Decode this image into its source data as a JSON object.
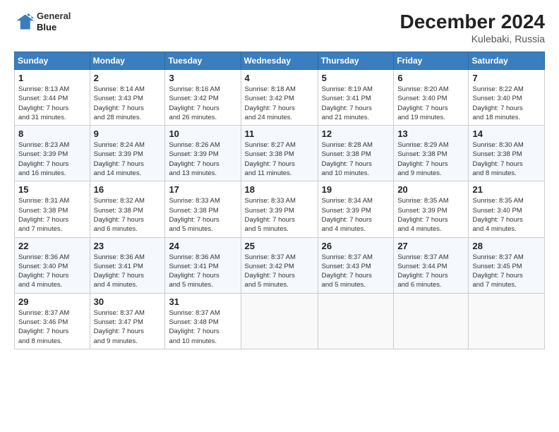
{
  "header": {
    "logo_line1": "General",
    "logo_line2": "Blue",
    "month_title": "December 2024",
    "subtitle": "Kulebaki, Russia"
  },
  "weekdays": [
    "Sunday",
    "Monday",
    "Tuesday",
    "Wednesday",
    "Thursday",
    "Friday",
    "Saturday"
  ],
  "weeks": [
    [
      {
        "day": "1",
        "info": "Sunrise: 8:13 AM\nSunset: 3:44 PM\nDaylight: 7 hours\nand 31 minutes."
      },
      {
        "day": "2",
        "info": "Sunrise: 8:14 AM\nSunset: 3:43 PM\nDaylight: 7 hours\nand 28 minutes."
      },
      {
        "day": "3",
        "info": "Sunrise: 8:16 AM\nSunset: 3:42 PM\nDaylight: 7 hours\nand 26 minutes."
      },
      {
        "day": "4",
        "info": "Sunrise: 8:18 AM\nSunset: 3:42 PM\nDaylight: 7 hours\nand 24 minutes."
      },
      {
        "day": "5",
        "info": "Sunrise: 8:19 AM\nSunset: 3:41 PM\nDaylight: 7 hours\nand 21 minutes."
      },
      {
        "day": "6",
        "info": "Sunrise: 8:20 AM\nSunset: 3:40 PM\nDaylight: 7 hours\nand 19 minutes."
      },
      {
        "day": "7",
        "info": "Sunrise: 8:22 AM\nSunset: 3:40 PM\nDaylight: 7 hours\nand 18 minutes."
      }
    ],
    [
      {
        "day": "8",
        "info": "Sunrise: 8:23 AM\nSunset: 3:39 PM\nDaylight: 7 hours\nand 16 minutes."
      },
      {
        "day": "9",
        "info": "Sunrise: 8:24 AM\nSunset: 3:39 PM\nDaylight: 7 hours\nand 14 minutes."
      },
      {
        "day": "10",
        "info": "Sunrise: 8:26 AM\nSunset: 3:39 PM\nDaylight: 7 hours\nand 13 minutes."
      },
      {
        "day": "11",
        "info": "Sunrise: 8:27 AM\nSunset: 3:38 PM\nDaylight: 7 hours\nand 11 minutes."
      },
      {
        "day": "12",
        "info": "Sunrise: 8:28 AM\nSunset: 3:38 PM\nDaylight: 7 hours\nand 10 minutes."
      },
      {
        "day": "13",
        "info": "Sunrise: 8:29 AM\nSunset: 3:38 PM\nDaylight: 7 hours\nand 9 minutes."
      },
      {
        "day": "14",
        "info": "Sunrise: 8:30 AM\nSunset: 3:38 PM\nDaylight: 7 hours\nand 8 minutes."
      }
    ],
    [
      {
        "day": "15",
        "info": "Sunrise: 8:31 AM\nSunset: 3:38 PM\nDaylight: 7 hours\nand 7 minutes."
      },
      {
        "day": "16",
        "info": "Sunrise: 8:32 AM\nSunset: 3:38 PM\nDaylight: 7 hours\nand 6 minutes."
      },
      {
        "day": "17",
        "info": "Sunrise: 8:33 AM\nSunset: 3:38 PM\nDaylight: 7 hours\nand 5 minutes."
      },
      {
        "day": "18",
        "info": "Sunrise: 8:33 AM\nSunset: 3:39 PM\nDaylight: 7 hours\nand 5 minutes."
      },
      {
        "day": "19",
        "info": "Sunrise: 8:34 AM\nSunset: 3:39 PM\nDaylight: 7 hours\nand 4 minutes."
      },
      {
        "day": "20",
        "info": "Sunrise: 8:35 AM\nSunset: 3:39 PM\nDaylight: 7 hours\nand 4 minutes."
      },
      {
        "day": "21",
        "info": "Sunrise: 8:35 AM\nSunset: 3:40 PM\nDaylight: 7 hours\nand 4 minutes."
      }
    ],
    [
      {
        "day": "22",
        "info": "Sunrise: 8:36 AM\nSunset: 3:40 PM\nDaylight: 7 hours\nand 4 minutes."
      },
      {
        "day": "23",
        "info": "Sunrise: 8:36 AM\nSunset: 3:41 PM\nDaylight: 7 hours\nand 4 minutes."
      },
      {
        "day": "24",
        "info": "Sunrise: 8:36 AM\nSunset: 3:41 PM\nDaylight: 7 hours\nand 5 minutes."
      },
      {
        "day": "25",
        "info": "Sunrise: 8:37 AM\nSunset: 3:42 PM\nDaylight: 7 hours\nand 5 minutes."
      },
      {
        "day": "26",
        "info": "Sunrise: 8:37 AM\nSunset: 3:43 PM\nDaylight: 7 hours\nand 5 minutes."
      },
      {
        "day": "27",
        "info": "Sunrise: 8:37 AM\nSunset: 3:44 PM\nDaylight: 7 hours\nand 6 minutes."
      },
      {
        "day": "28",
        "info": "Sunrise: 8:37 AM\nSunset: 3:45 PM\nDaylight: 7 hours\nand 7 minutes."
      }
    ],
    [
      {
        "day": "29",
        "info": "Sunrise: 8:37 AM\nSunset: 3:46 PM\nDaylight: 7 hours\nand 8 minutes."
      },
      {
        "day": "30",
        "info": "Sunrise: 8:37 AM\nSunset: 3:47 PM\nDaylight: 7 hours\nand 9 minutes."
      },
      {
        "day": "31",
        "info": "Sunrise: 8:37 AM\nSunset: 3:48 PM\nDaylight: 7 hours\nand 10 minutes."
      },
      null,
      null,
      null,
      null
    ]
  ]
}
